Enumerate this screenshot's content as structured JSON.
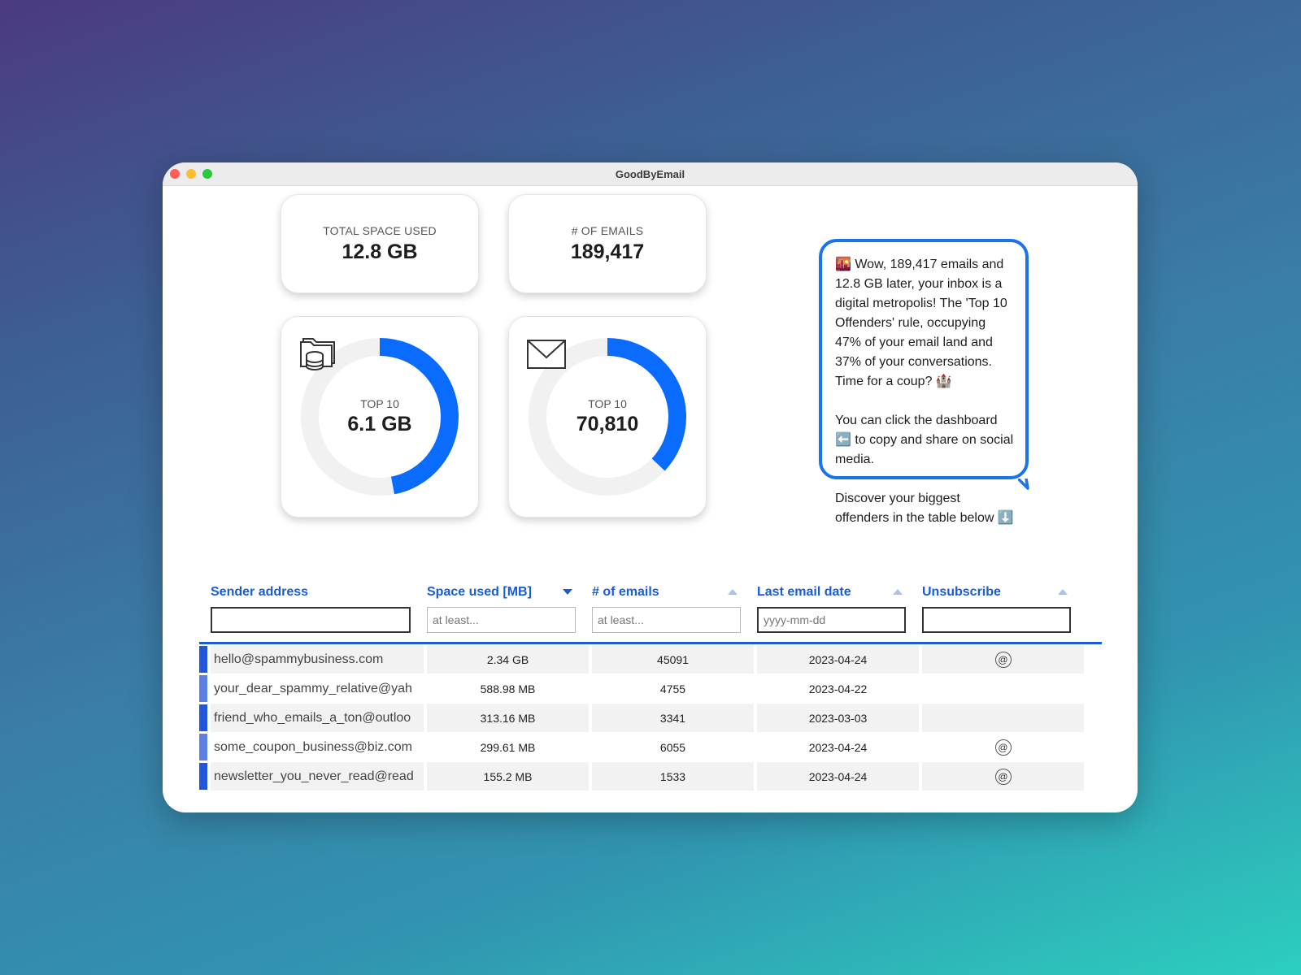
{
  "window": {
    "title": "GoodByEmail"
  },
  "stats": {
    "total_space_label": "TOTAL SPACE USED",
    "total_space_value": "12.8 GB",
    "emails_label": "# OF EMAILS",
    "emails_value": "189,417"
  },
  "donuts": [
    {
      "icon": "folder-database-icon",
      "label": "TOP 10",
      "value": "6.1 GB",
      "fraction": 0.47,
      "color": "#0a6cff"
    },
    {
      "icon": "envelope-icon",
      "label": "TOP 10",
      "value": "70,810",
      "fraction": 0.37,
      "color": "#0a6cff"
    }
  ],
  "bubble": {
    "p1": "🌇 Wow, 189,417 emails and 12.8 GB later, your inbox is a digital metropolis! The 'Top 10 Offenders' rule, occupying 47% of your email land and 37% of your conversations. Time for a coup? 🏰",
    "p2": "You can click the dashboard ⬅️ to copy and share on social media.",
    "p3": "Discover your biggest offenders in the table below ⬇️"
  },
  "table": {
    "headers": [
      "Sender address",
      "Space used [MB]",
      "# of emails",
      "Last email date",
      "Unsubscribe"
    ],
    "filters": {
      "sender": "",
      "space": "at least...",
      "emails": "at least...",
      "date": "yyyy-mm-dd",
      "unsubscribe": ""
    },
    "rows": [
      {
        "sender": "hello@spammybusiness.com",
        "space": "2.34 GB",
        "emails": "45091",
        "date": "2023-04-24",
        "unsubscribe": true
      },
      {
        "sender": "your_dear_spammy_relative@yah",
        "space": "588.98 MB",
        "emails": "4755",
        "date": "2023-04-22",
        "unsubscribe": false
      },
      {
        "sender": "friend_who_emails_a_ton@outloo",
        "space": "313.16 MB",
        "emails": "3341",
        "date": "2023-03-03",
        "unsubscribe": false
      },
      {
        "sender": "some_coupon_business@biz.com",
        "space": "299.61 MB",
        "emails": "6055",
        "date": "2023-04-24",
        "unsubscribe": true
      },
      {
        "sender": "newsletter_you_never_read@read",
        "space": "155.2 MB",
        "emails": "1533",
        "date": "2023-04-24",
        "unsubscribe": true
      }
    ],
    "marker_colors": [
      "#2255dd",
      "#5a80e6"
    ],
    "accent": "#1a5cd6"
  }
}
